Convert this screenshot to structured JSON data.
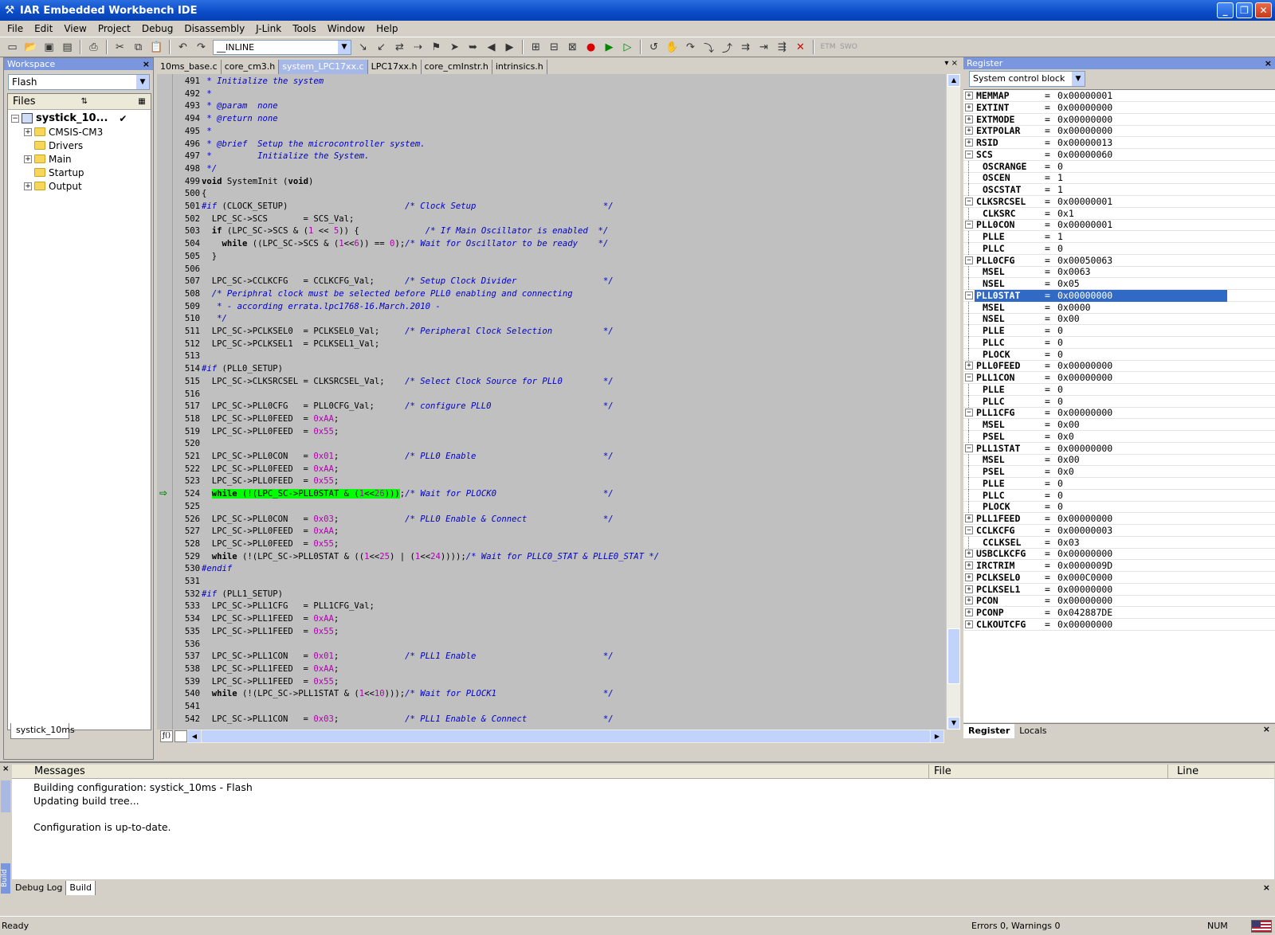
{
  "window": {
    "title": "IAR Embedded Workbench IDE",
    "min": "_",
    "max": "❐",
    "close": "✕"
  },
  "menu": [
    "File",
    "Edit",
    "View",
    "Project",
    "Debug",
    "Disassembly",
    "J-Link",
    "Tools",
    "Window",
    "Help"
  ],
  "toolbar": {
    "combo_value": "__INLINE",
    "etm": "ETM",
    "swo": "SWO"
  },
  "workspace": {
    "title": "Workspace",
    "config": "Flash",
    "files_header": "Files",
    "tab": "systick_10ms",
    "tree": [
      {
        "label": "systick_10...",
        "level": 0,
        "expander": "−",
        "type": "project",
        "check": "✔"
      },
      {
        "label": "CMSIS-CM3",
        "level": 1,
        "expander": "+",
        "type": "folder"
      },
      {
        "label": "Drivers",
        "level": 1,
        "expander": "",
        "type": "folder"
      },
      {
        "label": "Main",
        "level": 1,
        "expander": "+",
        "type": "folder"
      },
      {
        "label": "Startup",
        "level": 1,
        "expander": "",
        "type": "folder"
      },
      {
        "label": "Output",
        "level": 1,
        "expander": "+",
        "type": "folder"
      }
    ]
  },
  "editor": {
    "tabs": [
      "10ms_base.c",
      "core_cm3.h",
      "system_LPC17xx.c",
      "LPC17xx.h",
      "core_cmInstr.h",
      "intrinsics.h"
    ],
    "active_tab": 2,
    "current_line": 524,
    "lines": [
      {
        "n": 491,
        "h": " <c>* Initialize the system</c>"
      },
      {
        "n": 492,
        "h": " <c>*</c>"
      },
      {
        "n": 493,
        "h": " <c>* @param  none</c>"
      },
      {
        "n": 494,
        "h": " <c>* @return none</c>"
      },
      {
        "n": 495,
        "h": " <c>*</c>"
      },
      {
        "n": 496,
        "h": " <c>* @brief  Setup the microcontroller system.</c>"
      },
      {
        "n": 497,
        "h": " <c>*         Initialize the System.</c>"
      },
      {
        "n": 498,
        "h": " <c>*/</c>"
      },
      {
        "n": 499,
        "h": "<k>void</k> SystemInit (<k>void</k>)"
      },
      {
        "n": 500,
        "h": "{"
      },
      {
        "n": 501,
        "h": "<c>#if</c> (CLOCK_SETUP)                       <c>/* Clock Setup                         */</c>"
      },
      {
        "n": 502,
        "h": "  LPC_SC->SCS       = SCS_Val;"
      },
      {
        "n": 503,
        "h": "  <k>if</k> (LPC_SC->SCS & (<n>1</n> << <n>5</n>)) {             <c>/* If Main Oscillator is enabled  */</c>"
      },
      {
        "n": 504,
        "h": "    <k>while</k> ((LPC_SC->SCS & (<n>1</n><<<n>6</n>)) == <n>0</n>);<c>/* Wait for Oscillator to be ready    */</c>"
      },
      {
        "n": 505,
        "h": "  }"
      },
      {
        "n": 506,
        "h": ""
      },
      {
        "n": 507,
        "h": "  LPC_SC->CCLKCFG   = CCLKCFG_Val;      <c>/* Setup Clock Divider                 */</c>"
      },
      {
        "n": 508,
        "h": "  <c>/* Periphral clock must be selected before PLL0 enabling and connecting</c>"
      },
      {
        "n": 509,
        "h": "   <c>* - according errata.lpc1768-16.March.2010 -</c>"
      },
      {
        "n": 510,
        "h": "   <c>*/</c>"
      },
      {
        "n": 511,
        "h": "  LPC_SC->PCLKSEL0  = PCLKSEL0_Val;     <c>/* Peripheral Clock Selection          */</c>"
      },
      {
        "n": 512,
        "h": "  LPC_SC->PCLKSEL1  = PCLKSEL1_Val;"
      },
      {
        "n": 513,
        "h": ""
      },
      {
        "n": 514,
        "h": "<c>#if</c> (PLL0_SETUP)"
      },
      {
        "n": 515,
        "h": "  LPC_SC->CLKSRCSEL = CLKSRCSEL_Val;    <c>/* Select Clock Source for PLL0        */</c>"
      },
      {
        "n": 516,
        "h": ""
      },
      {
        "n": 517,
        "h": "  LPC_SC->PLL0CFG   = PLL0CFG_Val;      <c>/* configure PLL0                      */</c>"
      },
      {
        "n": 518,
        "h": "  LPC_SC->PLL0FEED  = <n>0xAA</n>;"
      },
      {
        "n": 519,
        "h": "  LPC_SC->PLL0FEED  = <n>0x55</n>;"
      },
      {
        "n": 520,
        "h": ""
      },
      {
        "n": 521,
        "h": "  LPC_SC->PLL0CON   = <n>0x01</n>;             <c>/* PLL0 Enable                         */</c>"
      },
      {
        "n": 522,
        "h": "  LPC_SC->PLL0FEED  = <n>0xAA</n>;"
      },
      {
        "n": 523,
        "h": "  LPC_SC->PLL0FEED  = <n>0x55</n>;"
      },
      {
        "n": 524,
        "h": "  <h><k>while</k> (!(LPC_SC->PLL0STAT & (<n>1</n><<<n>26</n>)))</h>;<c>/* Wait for PLOCK0                     */</c>"
      },
      {
        "n": 525,
        "h": ""
      },
      {
        "n": 526,
        "h": "  LPC_SC->PLL0CON   = <n>0x03</n>;             <c>/* PLL0 Enable & Connect               */</c>"
      },
      {
        "n": 527,
        "h": "  LPC_SC->PLL0FEED  = <n>0xAA</n>;"
      },
      {
        "n": 528,
        "h": "  LPC_SC->PLL0FEED  = <n>0x55</n>;"
      },
      {
        "n": 529,
        "h": "  <k>while</k> (!(LPC_SC->PLL0STAT & ((<n>1</n><<<n>25</n>) | (<n>1</n><<<n>24</n>))));<c>/* Wait for PLLC0_STAT & PLLE0_STAT */</c>"
      },
      {
        "n": 530,
        "h": "<c>#endif</c>"
      },
      {
        "n": 531,
        "h": ""
      },
      {
        "n": 532,
        "h": "<c>#if</c> (PLL1_SETUP)"
      },
      {
        "n": 533,
        "h": "  LPC_SC->PLL1CFG   = PLL1CFG_Val;"
      },
      {
        "n": 534,
        "h": "  LPC_SC->PLL1FEED  = <n>0xAA</n>;"
      },
      {
        "n": 535,
        "h": "  LPC_SC->PLL1FEED  = <n>0x55</n>;"
      },
      {
        "n": 536,
        "h": ""
      },
      {
        "n": 537,
        "h": "  LPC_SC->PLL1CON   = <n>0x01</n>;             <c>/* PLL1 Enable                         */</c>"
      },
      {
        "n": 538,
        "h": "  LPC_SC->PLL1FEED  = <n>0xAA</n>;"
      },
      {
        "n": 539,
        "h": "  LPC_SC->PLL1FEED  = <n>0x55</n>;"
      },
      {
        "n": 540,
        "h": "  <k>while</k> (!(LPC_SC->PLL1STAT & (<n>1</n><<<n>10</n>)));<c>/* Wait for PLOCK1                     */</c>"
      },
      {
        "n": 541,
        "h": ""
      },
      {
        "n": 542,
        "h": "  LPC_SC->PLL1CON   = <n>0x03</n>;             <c>/* PLL1 Enable & Connect               */</c>"
      }
    ]
  },
  "register": {
    "title": "Register",
    "group": "System control block",
    "tabs": [
      "Register",
      "Locals"
    ],
    "selected": "PLL0STAT",
    "rows": [
      {
        "name": "MEMMAP",
        "value": "0x00000001",
        "level": 0,
        "exp": "+"
      },
      {
        "name": "EXTINT",
        "value": "0x00000000",
        "level": 0,
        "exp": "+"
      },
      {
        "name": "EXTMODE",
        "value": "0x00000000",
        "level": 0,
        "exp": "+"
      },
      {
        "name": "EXTPOLAR",
        "value": "0x00000000",
        "level": 0,
        "exp": "+"
      },
      {
        "name": "RSID",
        "value": "0x00000013",
        "level": 0,
        "exp": "+"
      },
      {
        "name": "SCS",
        "value": "0x00000060",
        "level": 0,
        "exp": "−"
      },
      {
        "name": "OSCRANGE",
        "value": "0",
        "level": 1
      },
      {
        "name": "OSCEN",
        "value": "1",
        "level": 1
      },
      {
        "name": "OSCSTAT",
        "value": "1",
        "level": 1
      },
      {
        "name": "CLKSRCSEL",
        "value": "0x00000001",
        "level": 0,
        "exp": "−"
      },
      {
        "name": "CLKSRC",
        "value": "0x1",
        "level": 1
      },
      {
        "name": "PLL0CON",
        "value": "0x00000001",
        "level": 0,
        "exp": "−"
      },
      {
        "name": "PLLE",
        "value": "1",
        "level": 1
      },
      {
        "name": "PLLC",
        "value": "0",
        "level": 1
      },
      {
        "name": "PLL0CFG",
        "value": "0x00050063",
        "level": 0,
        "exp": "−"
      },
      {
        "name": "MSEL",
        "value": "0x0063",
        "level": 1
      },
      {
        "name": "NSEL",
        "value": "0x05",
        "level": 1
      },
      {
        "name": "PLL0STAT",
        "value": "0x00000000",
        "level": 0,
        "exp": "−"
      },
      {
        "name": "MSEL",
        "value": "0x0000",
        "level": 1
      },
      {
        "name": "NSEL",
        "value": "0x00",
        "level": 1
      },
      {
        "name": "PLLE",
        "value": "0",
        "level": 1
      },
      {
        "name": "PLLC",
        "value": "0",
        "level": 1
      },
      {
        "name": "PLOCK",
        "value": "0",
        "level": 1
      },
      {
        "name": "PLL0FEED",
        "value": "0x00000000",
        "level": 0,
        "exp": "+"
      },
      {
        "name": "PLL1CON",
        "value": "0x00000000",
        "level": 0,
        "exp": "−"
      },
      {
        "name": "PLLE",
        "value": "0",
        "level": 1
      },
      {
        "name": "PLLC",
        "value": "0",
        "level": 1
      },
      {
        "name": "PLL1CFG",
        "value": "0x00000000",
        "level": 0,
        "exp": "−"
      },
      {
        "name": "MSEL",
        "value": "0x00",
        "level": 1
      },
      {
        "name": "PSEL",
        "value": "0x0",
        "level": 1
      },
      {
        "name": "PLL1STAT",
        "value": "0x00000000",
        "level": 0,
        "exp": "−"
      },
      {
        "name": "MSEL",
        "value": "0x00",
        "level": 1
      },
      {
        "name": "PSEL",
        "value": "0x0",
        "level": 1
      },
      {
        "name": "PLLE",
        "value": "0",
        "level": 1
      },
      {
        "name": "PLLC",
        "value": "0",
        "level": 1
      },
      {
        "name": "PLOCK",
        "value": "0",
        "level": 1
      },
      {
        "name": "PLL1FEED",
        "value": "0x00000000",
        "level": 0,
        "exp": "+"
      },
      {
        "name": "CCLKCFG",
        "value": "0x00000003",
        "level": 0,
        "exp": "−"
      },
      {
        "name": "CCLKSEL",
        "value": "0x03",
        "level": 1
      },
      {
        "name": "USBCLKCFG",
        "value": "0x00000000",
        "level": 0,
        "exp": "+"
      },
      {
        "name": "IRCTRIM",
        "value": "0x0000009D",
        "level": 0,
        "exp": "+"
      },
      {
        "name": "PCLKSEL0",
        "value": "0x000C0000",
        "level": 0,
        "exp": "+"
      },
      {
        "name": "PCLKSEL1",
        "value": "0x00000000",
        "level": 0,
        "exp": "+"
      },
      {
        "name": "PCON",
        "value": "0x00000000",
        "level": 0,
        "exp": "+"
      },
      {
        "name": "PCONP",
        "value": "0x042887DE",
        "level": 0,
        "exp": "+"
      },
      {
        "name": "CLKOUTCFG",
        "value": "0x00000000",
        "level": 0,
        "exp": "+"
      }
    ]
  },
  "messages": {
    "col_messages": "Messages",
    "col_file": "File",
    "col_line": "Line",
    "side_label": "Build",
    "lines": [
      "Building configuration: systick_10ms - Flash",
      "Updating build tree...",
      "",
      "Configuration is up-to-date."
    ],
    "tabs": [
      "Debug Log",
      "Build"
    ],
    "active_tab": 1
  },
  "status": {
    "left": "Ready",
    "errors": "Errors 0, Warnings 0",
    "num": "NUM"
  }
}
